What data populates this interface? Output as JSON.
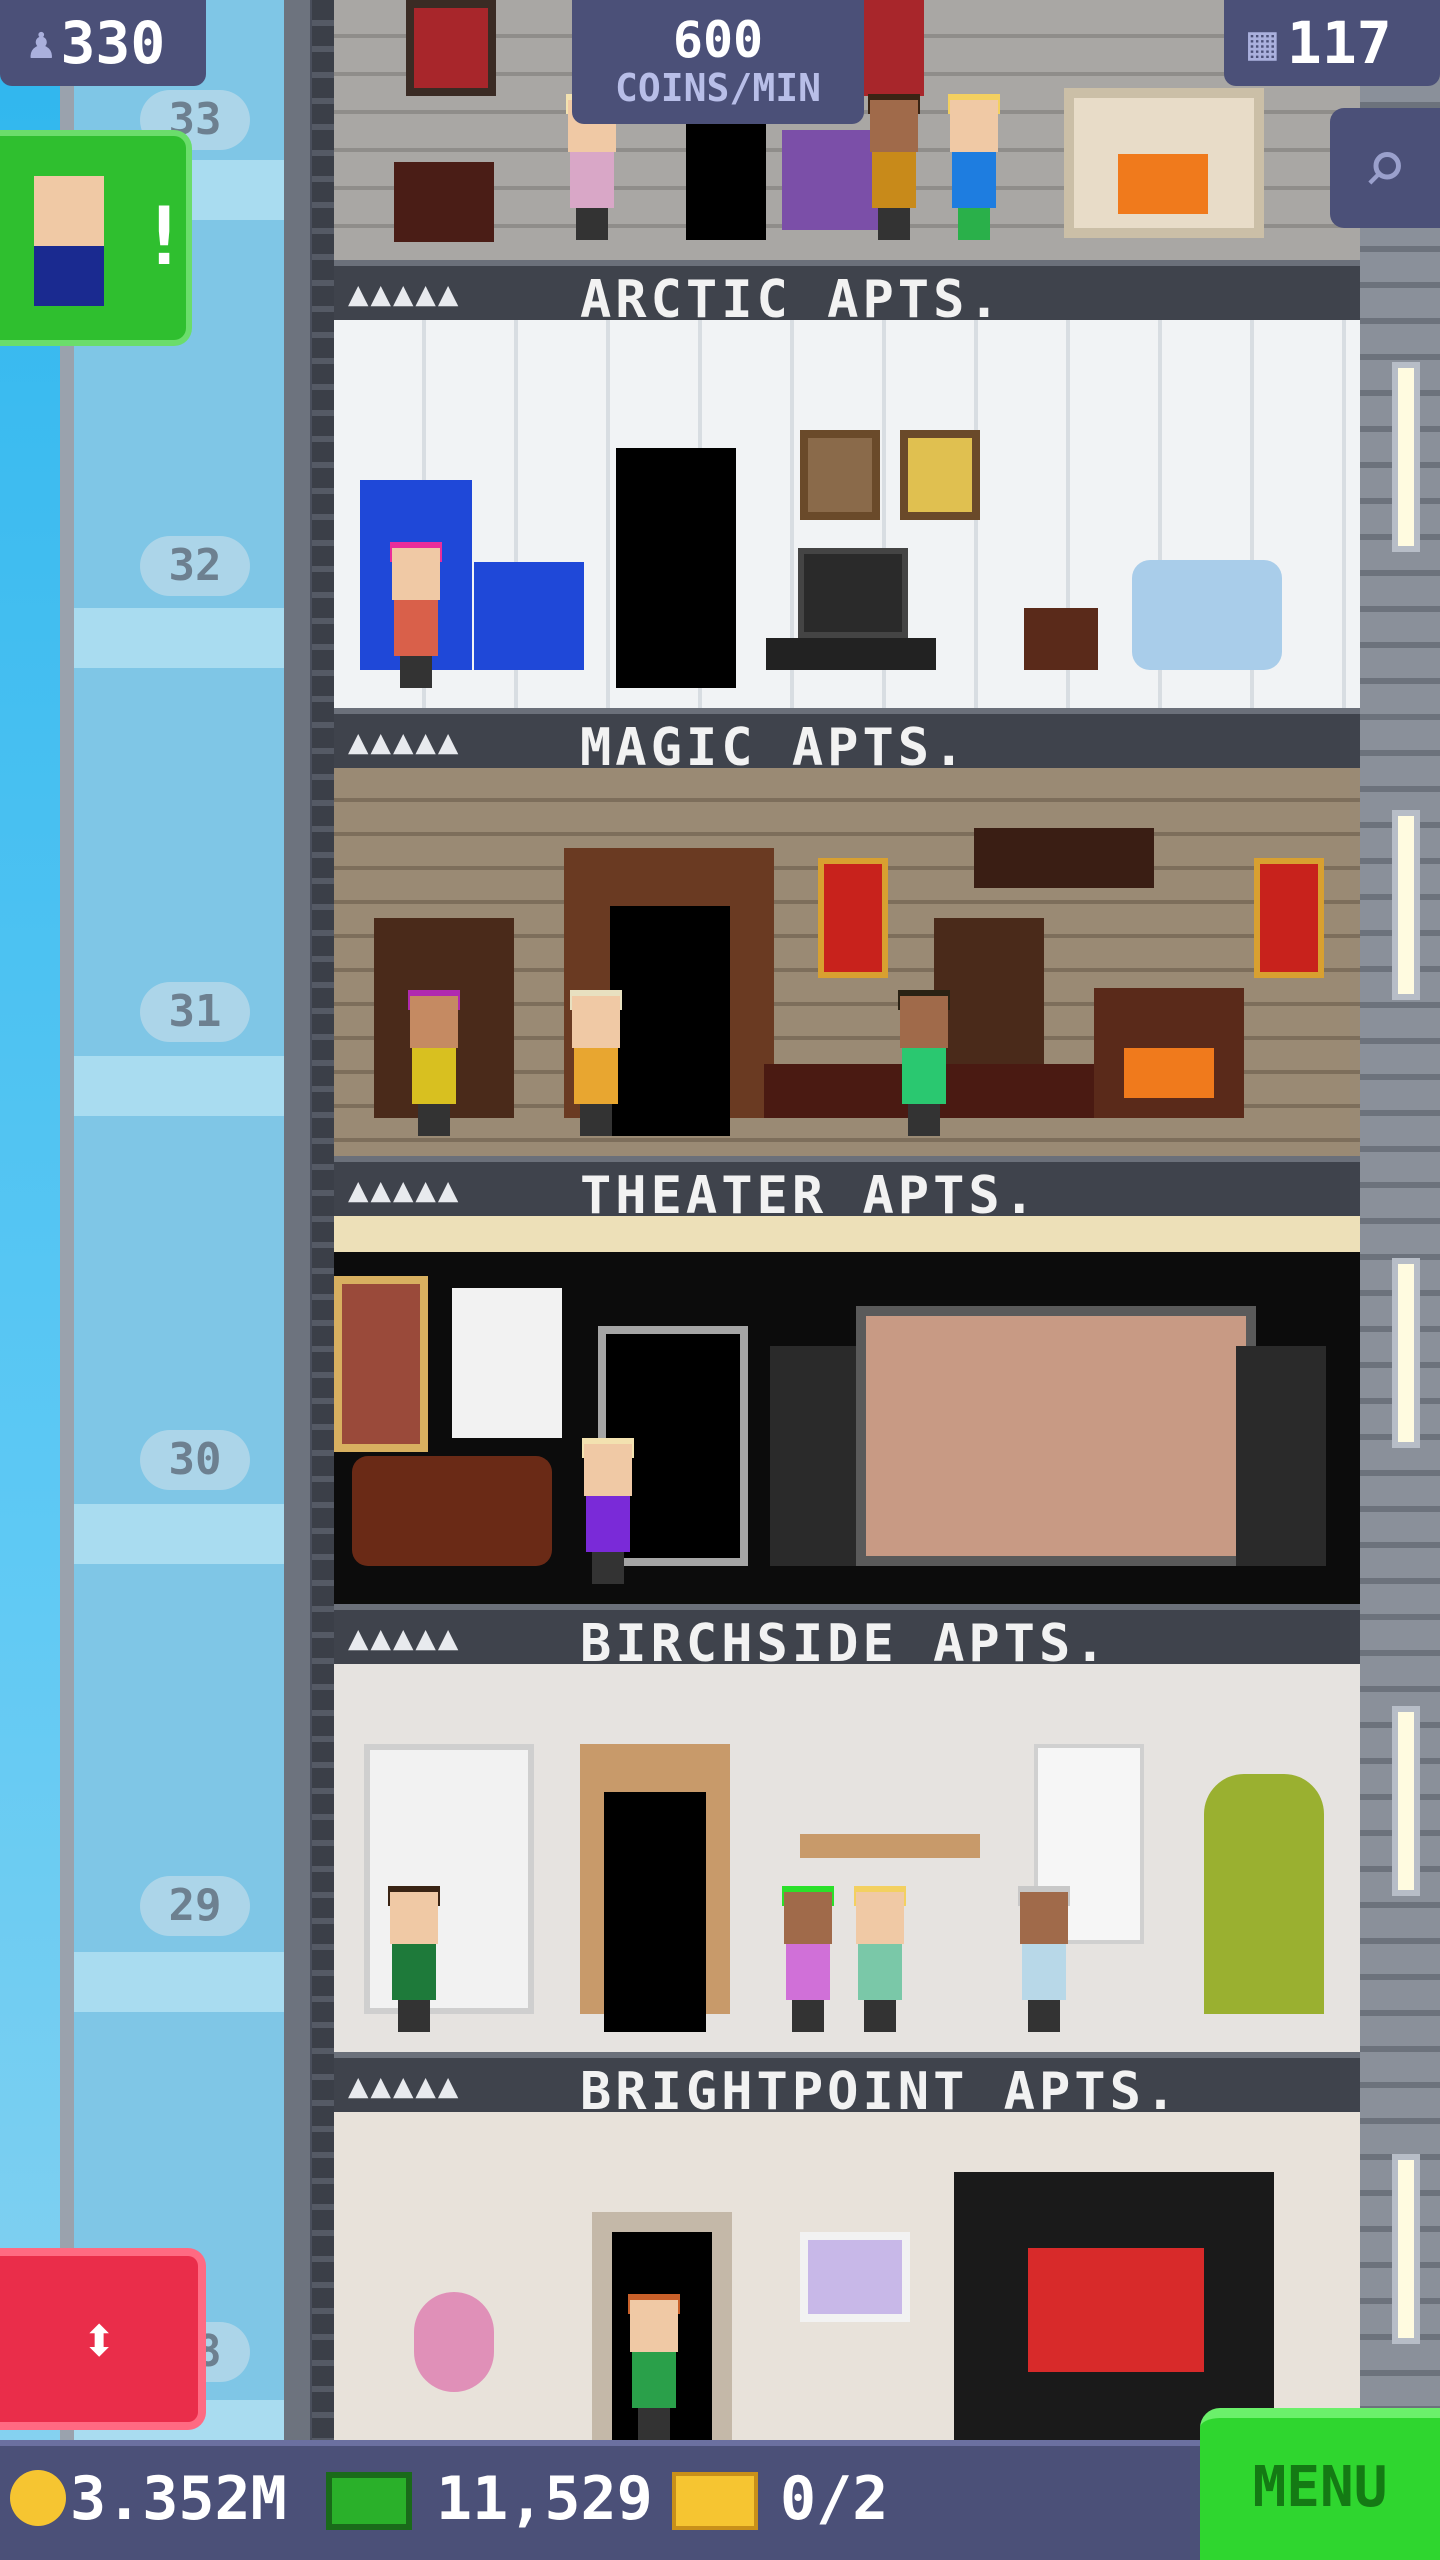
{
  "hud": {
    "population": "330",
    "coins_rate": "600",
    "coins_rate_unit": "COINS/MIN",
    "floors": "117"
  },
  "floor_numbers": [
    "33",
    "32",
    "31",
    "30",
    "29",
    "28"
  ],
  "floors": [
    {
      "name": "ARCTIC APTS.",
      "stars": "▲▲▲▲▲"
    },
    {
      "name": "MAGIC APTS.",
      "stars": "▲▲▲▲▲"
    },
    {
      "name": "THEATER APTS.",
      "stars": "▲▲▲▲▲"
    },
    {
      "name": "BIRCHSIDE APTS.",
      "stars": "▲▲▲▲▲"
    },
    {
      "name": "BRIGHTPOINT APTS.",
      "stars": "▲▲▲▲▲"
    }
  ],
  "bottom_bar": {
    "coins": "3.352M",
    "bux": "11,529",
    "tickets": "0/2",
    "menu_label": "MENU"
  },
  "icons": {
    "population": "person-icon",
    "floors": "building-icon",
    "search": "magnifier-icon",
    "elevator": "up-down-arrows-icon",
    "notification": "exclamation-icon",
    "coin": "coin-icon",
    "bux": "banknote-icon",
    "ticket": "vip-ticket-icon"
  },
  "colors": {
    "hud_bg": "#4b5078",
    "menu_green": "#2fd62f",
    "elevator_red": "#ea2d4a",
    "coin_yellow": "#f6c531"
  }
}
